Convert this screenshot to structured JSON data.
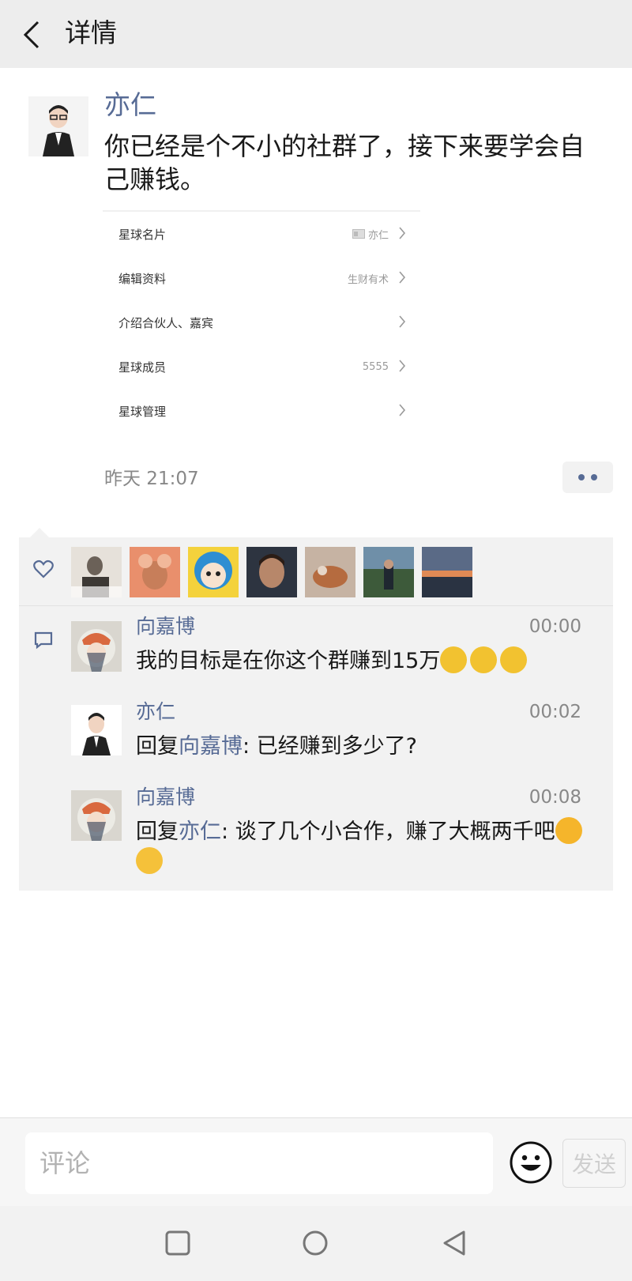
{
  "header": {
    "title": "详情"
  },
  "post": {
    "author": "亦仁",
    "content": "你已经是个不小的社群了，接下来要学会自己赚钱。",
    "time": "昨天 21:07",
    "screenshot": {
      "rows": [
        {
          "label": "星球名片",
          "value": "亦仁",
          "has_card_icon": true
        },
        {
          "label": "编辑资料",
          "value": "生财有术"
        },
        {
          "label": "介绍合伙人、嘉宾",
          "value": ""
        },
        {
          "label": "星球成员",
          "value": "5555"
        },
        {
          "label": "星球管理",
          "value": ""
        }
      ]
    }
  },
  "likes": {
    "avatar_colors": [
      "#6b6158",
      "#e98f6c",
      "#f4d23c",
      "#2d3440",
      "#b99a86",
      "#3d5a3a",
      "#3b4656"
    ]
  },
  "comments": [
    {
      "name": "向嘉博",
      "time": "00:00",
      "text": "我的目标是在你这个群赚到15万",
      "reply_to": "",
      "emojis": [
        "#f2c230",
        "#f2c230",
        "#f2c230"
      ]
    },
    {
      "name": "亦仁",
      "time": "00:02",
      "reply_prefix": "回复",
      "reply_to": "向嘉博",
      "text": ": 已经赚到多少了?",
      "emojis": []
    },
    {
      "name": "向嘉博",
      "time": "00:08",
      "reply_prefix": "回复",
      "reply_to": "亦仁",
      "text": ": 谈了几个小合作，赚了大概两千吧",
      "emojis": [
        "#f5b52b",
        "#f5c13a"
      ]
    }
  ],
  "input": {
    "placeholder": "评论",
    "send_label": "发送"
  },
  "colors": {
    "link": "#576b95",
    "background": "#ffffff",
    "panel": "#f2f2f2"
  }
}
